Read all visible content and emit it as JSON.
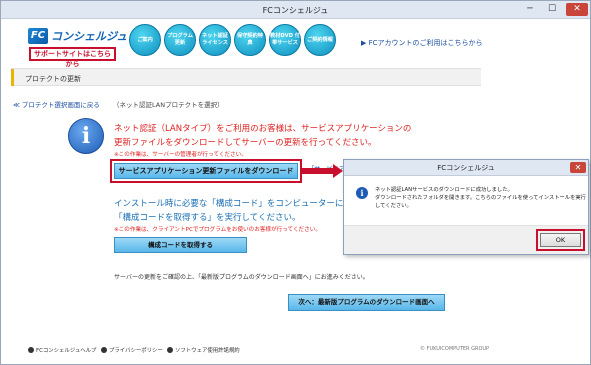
{
  "window": {
    "title": "FCコンシェルジュ",
    "minimize": "─",
    "maximize": "☐",
    "close": "✕"
  },
  "header": {
    "logo_fc": "FC",
    "logo_name": "コンシェルジュ",
    "support_button": "サポートサイトはこちらから",
    "nav": [
      {
        "label": "ご案内"
      },
      {
        "label": "プログラム更新"
      },
      {
        "label": "ネット認証ライセンス"
      },
      {
        "label": "保守契約特典"
      },
      {
        "label": "教材DVD 付帯サービス"
      },
      {
        "label": "ご契約情報"
      }
    ],
    "fc_account_link": "FCアカウントのご利用はこちらから"
  },
  "section": {
    "title": "プロテクトの更新"
  },
  "main": {
    "back_link": "≪ プロテクト選択画面に戻る",
    "back_note": "（ネット認証LANプロテクトを選択）",
    "red_line1": "ネット認証（LANタイプ）をご利用のお客様は、サービスアプリケーションの",
    "red_line2": "更新ファイルをダウンロードしてサーバーの更新を行ってください。",
    "note1": "※この作業は、サーバーの管理者が行ってください。",
    "download_button": "サービスアプリケーション更新ファイルをダウンロード",
    "service_link": "「サービスアプリケーション",
    "blue_line1": "インストール時に必要な「構成コード」をコンピューターにセット",
    "blue_line2": "「構成コードを取得する」を実行してください。",
    "note2": "※この作業は、クライアントPCでプログラムをお使いのお客様が行ってください。",
    "get_code_button": "構成コードを取得する",
    "update_note": "サーバーの更新をご確認の上、「最新版プログラムのダウンロード画面へ」にお進みください。",
    "next_button": "次へ：最新版プログラムのダウンロード画面へ"
  },
  "footer": {
    "links": [
      {
        "label": "FCコンシェルジュヘルプ"
      },
      {
        "label": "プライバシーポリシー"
      },
      {
        "label": "ソフトウェア使用許諾規約"
      }
    ],
    "copyright": "© FUKUICOMPUTER GROUP"
  },
  "dialog": {
    "title": "FCコンシェルジュ",
    "close": "✕",
    "icon": "i",
    "message_line1": "ネット認証LANサービスのダウンロードに成功しました。",
    "message_line2": "ダウンロードされたフォルダを開きます。こちらのファイルを使ってインストールを実行",
    "message_line3": "してください。",
    "ok_button": "OK"
  },
  "colors": {
    "accent_red": "#c8102e",
    "link_blue": "#1c4fa1",
    "nav_cyan": "#0e8fbf"
  }
}
